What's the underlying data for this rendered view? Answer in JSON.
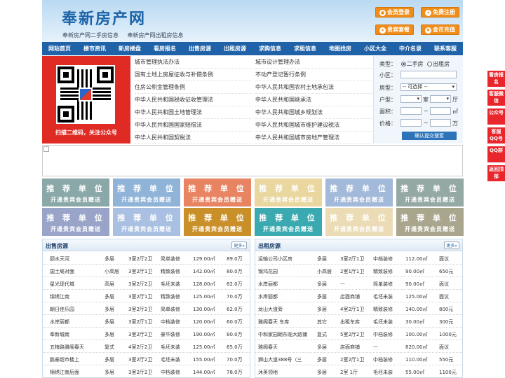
{
  "header": {
    "logo": "奉新房产网",
    "sublinks": [
      "奉新房产网二手房信息",
      "奉新房产网出租房信息"
    ],
    "buttons": [
      {
        "label": "会员登录",
        "icon": "user-icon"
      },
      {
        "label": "免费注册",
        "icon": "register-icon"
      },
      {
        "label": "贵宾套餐",
        "icon": "vip-icon"
      },
      {
        "label": "金币充值",
        "icon": "coin-icon"
      }
    ]
  },
  "nav": [
    "网站首页",
    "楼市资讯",
    "新房楼盘",
    "看房报名",
    "出售房源",
    "出租房源",
    "求购信息",
    "求租信息",
    "地图找房",
    "小区大全",
    "中介名录",
    "联系客服"
  ],
  "qr": {
    "caption": "扫描二维码，关注公众号"
  },
  "laws": {
    "left": [
      "城市管理执法办法",
      "国有土地上房屋征收与补偿条例",
      "住房公积金管理条例",
      "中华人民共和国税收征收管理法",
      "中华人民共和国土地管理法",
      "中华人民共和国国家赔偿法",
      "中华人民共和国契税法"
    ],
    "right": [
      "城市设计管理办法",
      "不动产登记暂行条例",
      "中华人民共和国农村土地承包法",
      "中华人民共和国继承法",
      "中华人民共和国城乡规划法",
      "中华人民共和国城市维护建设税法",
      "中华人民共和国城市房地产管理法"
    ]
  },
  "search": {
    "type_label": "类型：",
    "radio_sale": "二手房",
    "radio_rent": "出租房",
    "community_label": "小区：",
    "room_type_label": "房型：",
    "room_type_value": "-- 可选择 --",
    "layout_label": "户型：",
    "room_unit": "室",
    "hall_unit": "厅",
    "area_label": "面积：",
    "area_unit": "㎡",
    "price_label": "价格：",
    "price_unit": "万",
    "tilde": "~",
    "submit": "确认提交搜索"
  },
  "tiles": {
    "title": "推 荐 单 位",
    "subtitle": "开通贵宾会员赠送",
    "colors": [
      "#8aa8a8",
      "#8fb4d8",
      "#e88462",
      "#ead7a0",
      "#a3b9d9",
      "#94a8a4",
      "#9aa4c8",
      "#a9c0e2",
      "#c9902a",
      "#3aa9b0",
      "#ebdcb6",
      "#aaa68e"
    ]
  },
  "sale": {
    "title": "出售房源",
    "more": "更多»",
    "rows": [
      [
        "颐水天河",
        "多层",
        "3室2厅2卫",
        "简单装修",
        "129.00㎡",
        "89.0万"
      ],
      [
        "国土局对面",
        "小高层",
        "3室2厅1卫",
        "精致装修",
        "142.00㎡",
        "80.0万"
      ],
      [
        "星光现代城",
        "高层",
        "3室2厅2卫",
        "毛坯未装",
        "128.00㎡",
        "82.0万"
      ],
      [
        "锦绣江南",
        "多层",
        "3室2厅1卫",
        "精致装修",
        "125.00㎡",
        "70.0万"
      ],
      [
        "朝日佳乐园",
        "多层",
        "3室2厅2卫",
        "简单装修",
        "130.00㎡",
        "62.0万"
      ],
      [
        "水岸丽都",
        "多层",
        "3室2厅1卫",
        "中档装修",
        "120.00㎡",
        "60.0万"
      ],
      [
        "奉新城南",
        "多层",
        "3室2厅2卫",
        "豪华装修",
        "190.00㎡",
        "80.0万"
      ],
      [
        "五梅路雅阁春天",
        "复式",
        "4室2厅2卫",
        "毛坯未装",
        "125.00㎡",
        "65.0万"
      ],
      [
        "鹏泰超市楼上",
        "多层",
        "3室2厅2卫",
        "毛坯未装",
        "155.00㎡",
        "70.0万"
      ],
      [
        "锦绣江南后面",
        "多层",
        "3室2厅2卫",
        "中档装修",
        "144.00㎡",
        "78.0万"
      ]
    ]
  },
  "rent": {
    "title": "出租房源",
    "more": "更多»",
    "rows": [
      [
        "运输公司小区房",
        "多层",
        "3室2厅1卫",
        "中档装修",
        "112.00㎡",
        "面议"
      ],
      [
        "锦鸿花园",
        "小高层",
        "2室1厅1卫",
        "精致装修",
        "90.00㎡",
        "650元"
      ],
      [
        "水岸丽都",
        "多层",
        "—",
        "简单装修",
        "90.00㎡",
        "面议"
      ],
      [
        "水岸丽都",
        "多层",
        "店面商铺",
        "毛坯未装",
        "125.00㎡",
        "面议"
      ],
      [
        "龙山大道旁",
        "多层",
        "4室2厅1卫",
        "精致装修",
        "140.00㎡",
        "800元"
      ],
      [
        "雅阁春天 车库",
        "其它",
        "出租车库",
        "毛坯未装",
        "30.00㎡",
        "300元"
      ],
      [
        "中和家园朝东临大路铺",
        "复式",
        "5室2厅2卫",
        "中档装修",
        "100.00㎡",
        "1000元"
      ],
      [
        "雅阁春天",
        "多层",
        "店面商铺",
        "—",
        "820.00㎡",
        "面议"
      ],
      [
        "狮山大道388号（三",
        "多层",
        "2室2厅1卫",
        "中档装修",
        "110.00㎡",
        "550元"
      ],
      [
        "沐英领地",
        "多层",
        "2室 1厅",
        "毛坯未装",
        "55.00㎡",
        "1100元"
      ]
    ]
  },
  "sidebar": [
    "看房报名",
    "客服微信",
    "公众号",
    "客服QQ号",
    "QQ群",
    "返回顶部"
  ],
  "colors": {
    "nav": "#1f62a8",
    "accent": "#f08d1a",
    "sidebar": "#e8262c",
    "qr_bg": "#e02a24"
  }
}
